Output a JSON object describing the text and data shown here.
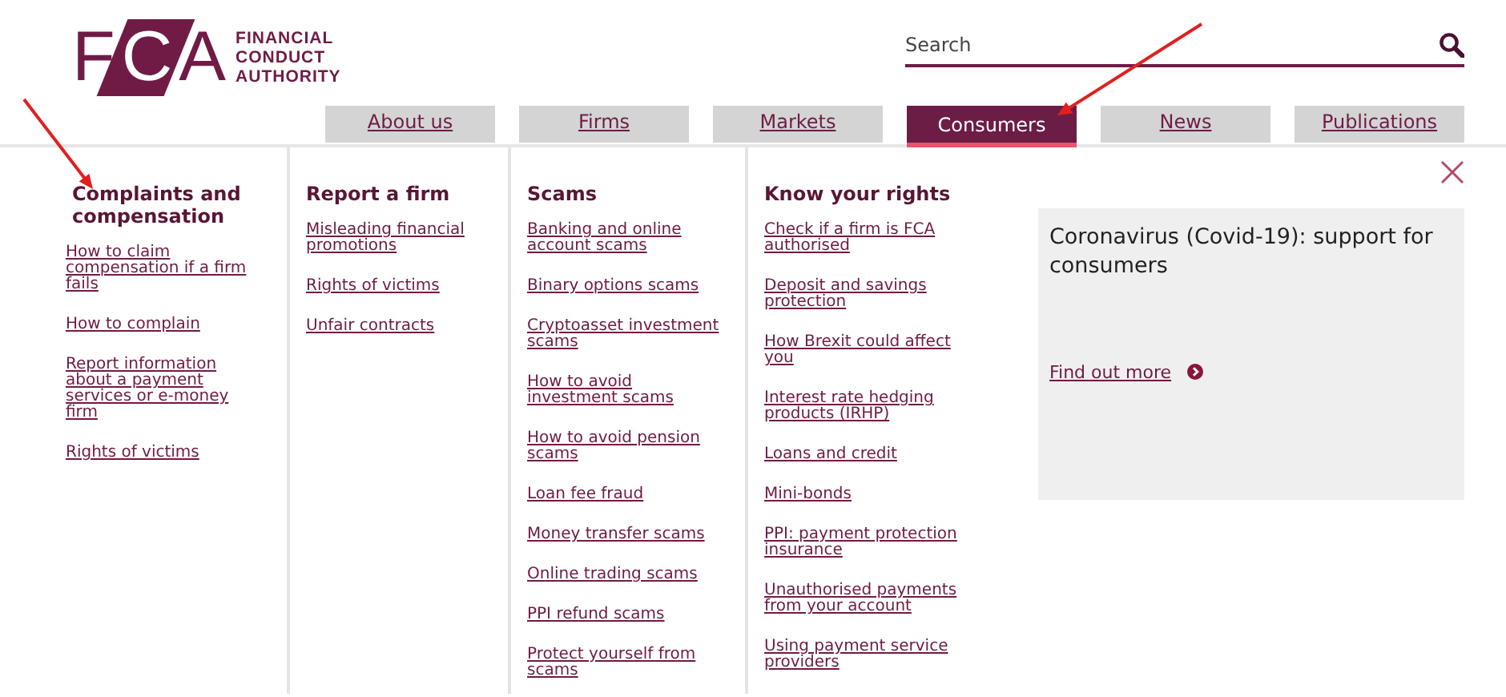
{
  "logo": {
    "letters": "FCA",
    "lines": [
      "FINANCIAL",
      "CONDUCT",
      "AUTHORITY"
    ]
  },
  "search": {
    "placeholder": "Search"
  },
  "tabs": [
    {
      "label": "About us",
      "selected": false
    },
    {
      "label": "Firms",
      "selected": false
    },
    {
      "label": "Markets",
      "selected": false
    },
    {
      "label": "Consumers",
      "selected": true
    },
    {
      "label": "News",
      "selected": false
    },
    {
      "label": "Publications",
      "selected": false
    }
  ],
  "menu_columns": [
    {
      "heading": "Complaints and compensation",
      "links": [
        "How to claim compensation if a firm fails",
        "How to complain",
        "Report information about a payment services or e-money firm",
        "Rights of victims"
      ]
    },
    {
      "heading": "Report a firm",
      "links": [
        "Misleading financial promotions",
        "Rights of victims",
        "Unfair contracts"
      ]
    },
    {
      "heading": "Scams",
      "links": [
        "Banking and online account scams",
        "Binary options scams",
        "Cryptoasset investment scams",
        "How to avoid investment scams",
        "How to avoid pension scams",
        "Loan fee fraud",
        "Money transfer scams",
        "Online trading scams",
        "PPI refund scams",
        "Protect yourself from scams"
      ]
    },
    {
      "heading": "Know your rights",
      "links": [
        "Check if a firm is FCA authorised",
        "Deposit and savings protection",
        "How Brexit could affect you",
        "Interest rate hedging products (IRHP)",
        "Loans and credit",
        "Mini-bonds",
        "PPI: payment protection insurance",
        "Unauthorised payments from your account",
        "Using payment service providers"
      ]
    }
  ],
  "promo": {
    "title": "Coronavirus (Covid-19): support for consumers",
    "link": "Find out more"
  },
  "annotations": [
    {
      "kind": "arrow-down-right"
    },
    {
      "kind": "arrow-down-left"
    }
  ]
}
